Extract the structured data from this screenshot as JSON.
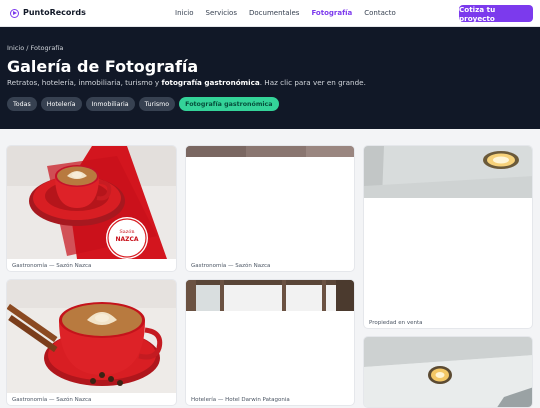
{
  "nav": {
    "brand": "PuntoRecords",
    "links": [
      "Inicio",
      "Servicios",
      "Documentales",
      "Fotografía",
      "Contacto"
    ],
    "active_index": 3,
    "cta": "Cotiza tu proyecto"
  },
  "hero": {
    "breadcrumb": "Inicio / Fotografía",
    "title": "Galería de Fotografía",
    "subtitle_plain": "Retratos, hotelería, inmobiliaria, turismo y",
    "subtitle_bold": "fotografía gastronómica",
    "subtitle_end": ". Haz clic para ver en grande.",
    "filters": [
      "Todas",
      "Hotelería",
      "Inmobiliaria",
      "Turismo",
      "Fotografía gastronómica"
    ],
    "active_filter": 4
  },
  "gallery": [
    {
      "caption": "Gastronomía — Sazón Nazca",
      "logo_line1": "Sazón",
      "logo_line2": "NAZCA"
    },
    {
      "caption": "Gastronomía — Sazón Nazca"
    },
    {
      "caption": "Propiedad en venta"
    },
    {
      "caption": "Gastronomía — Sazón Nazca"
    },
    {
      "caption": "Hotelería — Hotel Darwin Patagonia"
    },
    {
      "caption": ""
    }
  ],
  "colors": {
    "accent": "#7c3aed",
    "hero_bg": "#111827",
    "active_chip": "#34d399"
  }
}
